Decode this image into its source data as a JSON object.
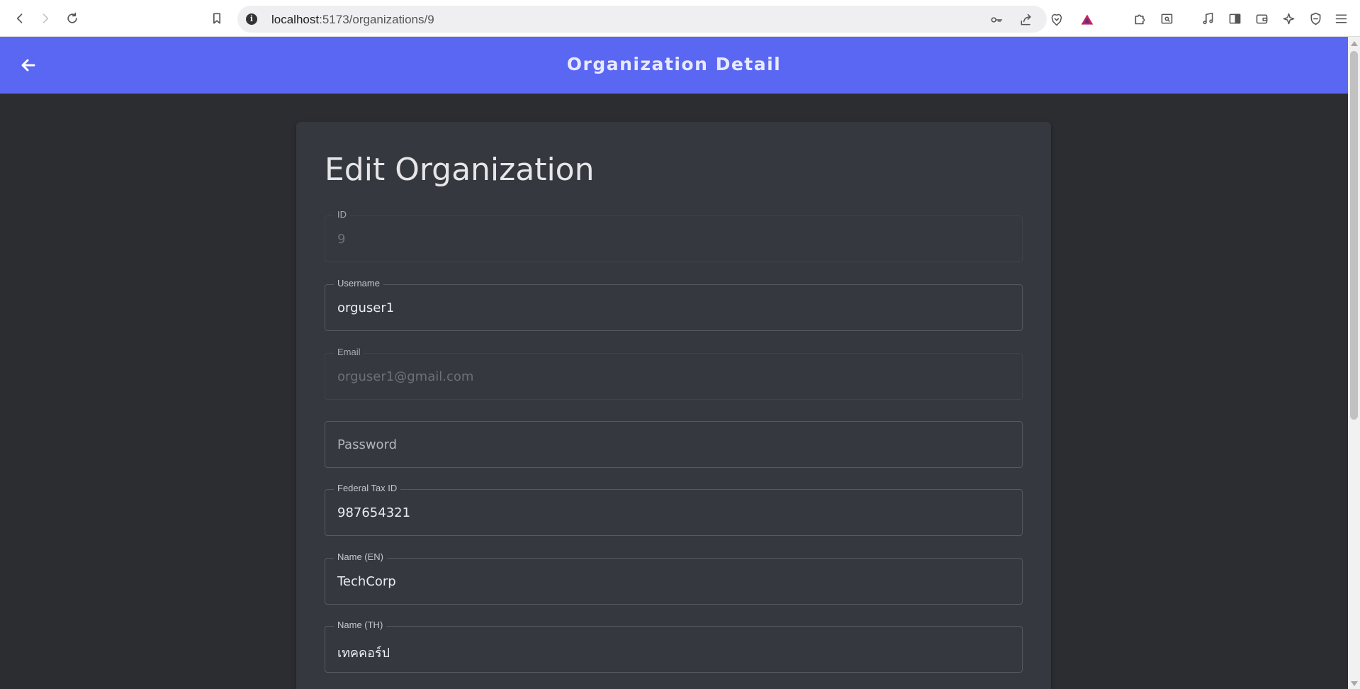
{
  "browser": {
    "url_host": "localhost",
    "url_path": ":5173/organizations/9"
  },
  "header": {
    "title": "Organization Detail"
  },
  "form": {
    "title": "Edit Organization",
    "fields": {
      "id": {
        "label": "ID",
        "value": "9",
        "disabled": true
      },
      "username": {
        "label": "Username",
        "value": "orguser1"
      },
      "email": {
        "label": "Email",
        "value": "orguser1@gmail.com",
        "disabled": true
      },
      "password": {
        "placeholder": "Password"
      },
      "federal_tax_id": {
        "label": "Federal Tax ID",
        "value": "987654321"
      },
      "name_en": {
        "label": "Name (EN)",
        "value": "TechCorp"
      },
      "name_th": {
        "label": "Name (TH)",
        "value": "เทคคอร์ป"
      }
    }
  },
  "colors": {
    "header_bg": "#5a67f2",
    "page_bg": "#2b2d31",
    "card_bg": "#363840"
  }
}
